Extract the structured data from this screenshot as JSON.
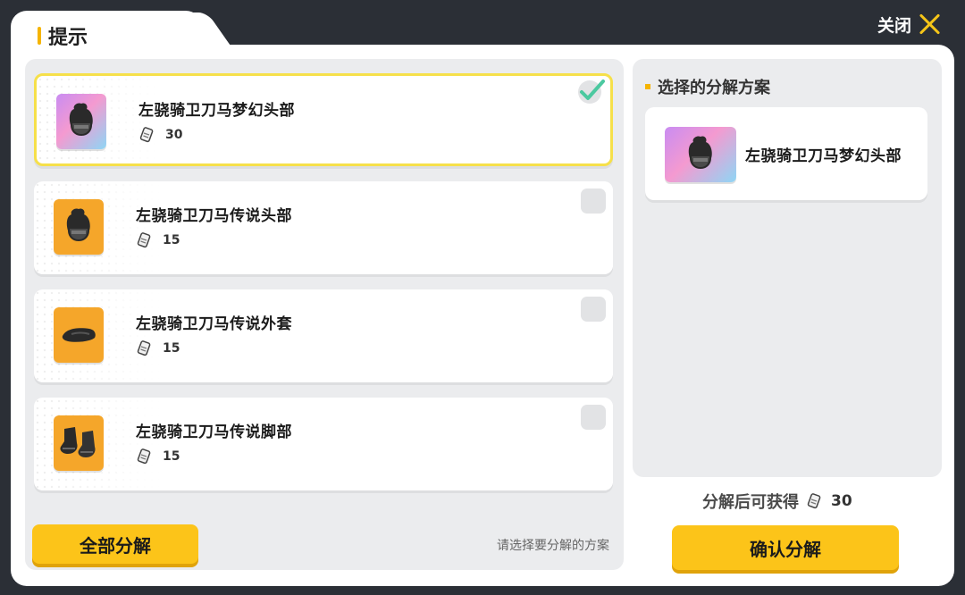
{
  "dialog": {
    "title": "提示",
    "close_label": "关闭"
  },
  "items": [
    {
      "name": "左骁骑卫刀马梦幻头部",
      "value": "30",
      "rarity": "dream",
      "icon": "helmet-icon",
      "selected": true
    },
    {
      "name": "左骁骑卫刀马传说头部",
      "value": "15",
      "rarity": "legend",
      "icon": "helmet-icon",
      "selected": false
    },
    {
      "name": "左骁骑卫刀马传说外套",
      "value": "15",
      "rarity": "legend",
      "icon": "coat-icon",
      "selected": false
    },
    {
      "name": "左骁骑卫刀马传说脚部",
      "value": "15",
      "rarity": "legend",
      "icon": "boots-icon",
      "selected": false
    }
  ],
  "left_footer": {
    "decompose_all_label": "全部分解",
    "hint": "请选择要分解的方案"
  },
  "plan": {
    "title": "选择的分解方案",
    "selected_item_name": "左骁骑卫刀马梦幻头部"
  },
  "result": {
    "label": "分解后可获得",
    "value": "30"
  },
  "confirm_label": "确认分解",
  "colors": {
    "accent_yellow": "#fcc419",
    "selected_border": "#f6e04a",
    "legend_orange": "#f5a62a",
    "check_green": "#4cc9a0"
  }
}
